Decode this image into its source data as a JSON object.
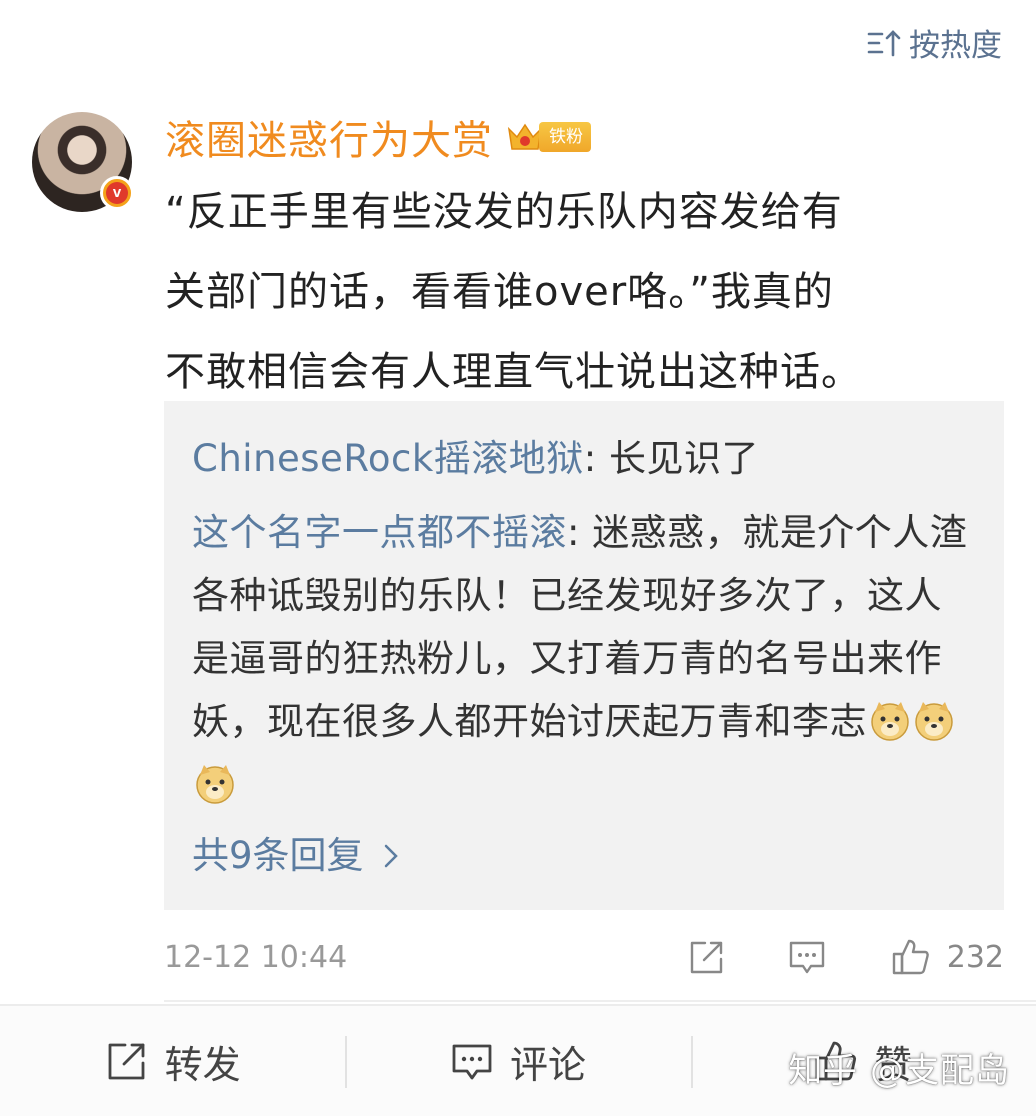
{
  "sort": {
    "label": "按热度",
    "icon": "sort-icon"
  },
  "comment": {
    "username": "滚圈迷惑行为大赏",
    "fan_badge": "铁粉",
    "text_lines": [
      "“反正手里有些没发的乐队内容发给有",
      "关部门的话，看看谁over咯。”我真的",
      "不敢相信会有人理直气壮说出这种话。"
    ],
    "timestamp": "12-12 10:44",
    "like_count": "232"
  },
  "replies": [
    {
      "user": "ChineseRock摇滚地狱",
      "text": ": 长见识了"
    },
    {
      "user": "这个名字一点都不摇滚",
      "text": ": 迷惑惑，就是介个人渣各种诋毁别的乐队！已经发现好多次了，这人是逼哥的狂热粉儿，又打着万青的名号出来作妖，现在很多人都开始讨厌起万青和李志"
    }
  ],
  "more_replies": "共9条回复",
  "bottom_bar": {
    "repost": "转发",
    "comment": "评论",
    "like": "赞"
  },
  "watermark": "知乎 @支配岛",
  "colors": {
    "username": "#f08b1f",
    "link_blue": "#5b7ca0",
    "reply_bg": "#f2f2f2",
    "timestamp": "#999999"
  }
}
